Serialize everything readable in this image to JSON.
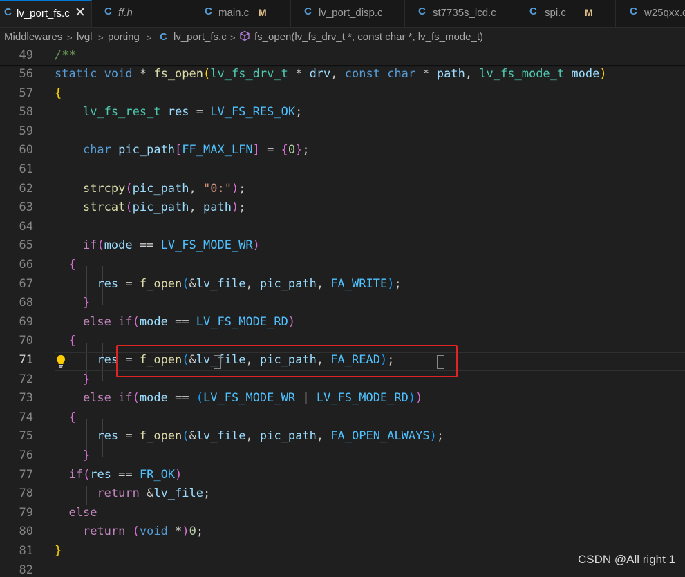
{
  "tabs": [
    {
      "icon": "C",
      "label": "lv_port_fs.c",
      "close": "✕"
    },
    {
      "icon": "C",
      "label": "ff.h"
    },
    {
      "icon": "C",
      "label": "main.c",
      "badge": "M"
    },
    {
      "icon": "C",
      "label": "lv_port_disp.c"
    },
    {
      "icon": "C",
      "label": "st7735s_lcd.c"
    },
    {
      "icon": "C",
      "label": "spi.c",
      "badge": "M"
    },
    {
      "icon": "C",
      "label": "w25qxx.c"
    }
  ],
  "breadcrumb": {
    "segments": [
      "Middlewares",
      "lvgl",
      "porting"
    ],
    "file_icon": "C",
    "file": "lv_port_fs.c",
    "symbol": "fs_open(lv_fs_drv_t *, const char *, lv_fs_mode_t)"
  },
  "editor": {
    "sticky_line": {
      "num": "49",
      "text": "/**"
    },
    "current_line": "71",
    "lines": [
      {
        "num": "56",
        "tokens": [
          [
            "static",
            "kw"
          ],
          [
            " ",
            ""
          ],
          [
            "void",
            "kw"
          ],
          [
            " * ",
            ""
          ],
          [
            "fs_open",
            "fn"
          ],
          [
            "(",
            "by"
          ],
          [
            "lv_fs_drv_t",
            "ty"
          ],
          [
            " * ",
            ""
          ],
          [
            "drv",
            "va"
          ],
          [
            ", ",
            ""
          ],
          [
            "const",
            "kw"
          ],
          [
            " ",
            ""
          ],
          [
            "char",
            "kw"
          ],
          [
            " * ",
            ""
          ],
          [
            "path",
            "va"
          ],
          [
            ", ",
            ""
          ],
          [
            "lv_fs_mode_t",
            "ty"
          ],
          [
            " ",
            ""
          ],
          [
            "mode",
            "va"
          ],
          [
            ")",
            "by"
          ]
        ]
      },
      {
        "num": "57",
        "tokens": [
          [
            "{",
            "by"
          ]
        ]
      },
      {
        "num": "58",
        "tokens": [
          [
            "    ",
            ""
          ],
          [
            "lv_fs_res_t",
            "ty"
          ],
          [
            " ",
            ""
          ],
          [
            "res",
            "va"
          ],
          [
            " = ",
            ""
          ],
          [
            "LV_FS_RES_OK",
            "cn"
          ],
          [
            ";",
            ""
          ]
        ]
      },
      {
        "num": "59",
        "tokens": []
      },
      {
        "num": "60",
        "tokens": [
          [
            "    ",
            ""
          ],
          [
            "char",
            "kw"
          ],
          [
            " ",
            ""
          ],
          [
            "pic_path",
            "va"
          ],
          [
            "[",
            "bp"
          ],
          [
            "FF_MAX_LFN",
            "cn"
          ],
          [
            "]",
            "bp"
          ],
          [
            " = ",
            ""
          ],
          [
            "{",
            "bp"
          ],
          [
            "0",
            "nu"
          ],
          [
            "}",
            "bp"
          ],
          [
            ";",
            ""
          ]
        ]
      },
      {
        "num": "61",
        "tokens": []
      },
      {
        "num": "62",
        "tokens": [
          [
            "    ",
            ""
          ],
          [
            "strcpy",
            "fn"
          ],
          [
            "(",
            "bp"
          ],
          [
            "pic_path",
            "va"
          ],
          [
            ", ",
            ""
          ],
          [
            "\"0:\"",
            "st"
          ],
          [
            ")",
            "bp"
          ],
          [
            ";",
            ""
          ]
        ]
      },
      {
        "num": "63",
        "tokens": [
          [
            "    ",
            ""
          ],
          [
            "strcat",
            "fn"
          ],
          [
            "(",
            "bp"
          ],
          [
            "pic_path",
            "va"
          ],
          [
            ", ",
            ""
          ],
          [
            "path",
            "va"
          ],
          [
            ")",
            "bp"
          ],
          [
            ";",
            ""
          ]
        ]
      },
      {
        "num": "64",
        "tokens": []
      },
      {
        "num": "65",
        "tokens": [
          [
            "    ",
            ""
          ],
          [
            "if",
            "ctl"
          ],
          [
            "(",
            "bp"
          ],
          [
            "mode",
            "va"
          ],
          [
            " == ",
            ""
          ],
          [
            "LV_FS_MODE_WR",
            "cn"
          ],
          [
            ")",
            "bp"
          ]
        ]
      },
      {
        "num": "66",
        "tokens": [
          [
            "  ",
            ""
          ],
          [
            "{",
            "bp"
          ]
        ]
      },
      {
        "num": "67",
        "tokens": [
          [
            "      ",
            ""
          ],
          [
            "res",
            "va"
          ],
          [
            " = ",
            ""
          ],
          [
            "f_open",
            "fn"
          ],
          [
            "(",
            "bb"
          ],
          [
            "&",
            ""
          ],
          [
            "lv_file",
            "va"
          ],
          [
            ", ",
            ""
          ],
          [
            "pic_path",
            "va"
          ],
          [
            ", ",
            ""
          ],
          [
            "FA_WRITE",
            "cn"
          ],
          [
            ")",
            "bb"
          ],
          [
            ";",
            ""
          ]
        ]
      },
      {
        "num": "68",
        "tokens": [
          [
            "    ",
            ""
          ],
          [
            "}",
            "bp"
          ]
        ]
      },
      {
        "num": "69",
        "tokens": [
          [
            "    ",
            ""
          ],
          [
            "else",
            "ctl"
          ],
          [
            " ",
            ""
          ],
          [
            "if",
            "ctl"
          ],
          [
            "(",
            "bp"
          ],
          [
            "mode",
            "va"
          ],
          [
            " == ",
            ""
          ],
          [
            "LV_FS_MODE_RD",
            "cn"
          ],
          [
            ")",
            "bp"
          ]
        ]
      },
      {
        "num": "70",
        "tokens": [
          [
            "  ",
            ""
          ],
          [
            "{",
            "bp"
          ]
        ]
      },
      {
        "num": "71",
        "tokens": [
          [
            "      ",
            ""
          ],
          [
            "res",
            "va"
          ],
          [
            " = ",
            ""
          ],
          [
            "f_open",
            "fn"
          ],
          [
            "(",
            "bb"
          ],
          [
            "&",
            ""
          ],
          [
            "lv_file",
            "va"
          ],
          [
            ", ",
            ""
          ],
          [
            "pic_path",
            "va"
          ],
          [
            ", ",
            ""
          ],
          [
            "FA_READ",
            "cn"
          ],
          [
            ")",
            "bb"
          ],
          [
            ";",
            ""
          ]
        ]
      },
      {
        "num": "72",
        "tokens": [
          [
            "    ",
            ""
          ],
          [
            "}",
            "bp"
          ]
        ]
      },
      {
        "num": "73",
        "tokens": [
          [
            "    ",
            ""
          ],
          [
            "else",
            "ctl"
          ],
          [
            " ",
            ""
          ],
          [
            "if",
            "ctl"
          ],
          [
            "(",
            "bp"
          ],
          [
            "mode",
            "va"
          ],
          [
            " == ",
            ""
          ],
          [
            "(",
            "bb"
          ],
          [
            "LV_FS_MODE_WR",
            "cn"
          ],
          [
            " | ",
            ""
          ],
          [
            "LV_FS_MODE_RD",
            "cn"
          ],
          [
            ")",
            "bb"
          ],
          [
            ")",
            "bp"
          ]
        ]
      },
      {
        "num": "74",
        "tokens": [
          [
            "  ",
            ""
          ],
          [
            "{",
            "bp"
          ]
        ]
      },
      {
        "num": "75",
        "tokens": [
          [
            "      ",
            ""
          ],
          [
            "res",
            "va"
          ],
          [
            " = ",
            ""
          ],
          [
            "f_open",
            "fn"
          ],
          [
            "(",
            "bb"
          ],
          [
            "&",
            ""
          ],
          [
            "lv_file",
            "va"
          ],
          [
            ", ",
            ""
          ],
          [
            "pic_path",
            "va"
          ],
          [
            ", ",
            ""
          ],
          [
            "FA_OPEN_ALWAYS",
            "cn"
          ],
          [
            ")",
            "bb"
          ],
          [
            ";",
            ""
          ]
        ]
      },
      {
        "num": "76",
        "tokens": [
          [
            "    ",
            ""
          ],
          [
            "}",
            "bp"
          ]
        ]
      },
      {
        "num": "77",
        "tokens": [
          [
            "  ",
            ""
          ],
          [
            "if",
            "ctl"
          ],
          [
            "(",
            "bp"
          ],
          [
            "res",
            "va"
          ],
          [
            " == ",
            ""
          ],
          [
            "FR_OK",
            "cn"
          ],
          [
            ")",
            "bp"
          ]
        ]
      },
      {
        "num": "78",
        "tokens": [
          [
            "      ",
            ""
          ],
          [
            "return",
            "ctl"
          ],
          [
            " &",
            ""
          ],
          [
            "lv_file",
            "va"
          ],
          [
            ";",
            ""
          ]
        ]
      },
      {
        "num": "79",
        "tokens": [
          [
            "  ",
            ""
          ],
          [
            "else",
            "ctl"
          ]
        ]
      },
      {
        "num": "80",
        "tokens": [
          [
            "    ",
            ""
          ],
          [
            "return",
            "ctl"
          ],
          [
            " ",
            ""
          ],
          [
            "(",
            "bp"
          ],
          [
            "void",
            "kw"
          ],
          [
            " *",
            ""
          ],
          [
            ")",
            "bp"
          ],
          [
            "0",
            "nu"
          ],
          [
            ";",
            ""
          ]
        ]
      },
      {
        "num": "81",
        "tokens": [
          [
            "}",
            "by"
          ]
        ]
      },
      {
        "num": "82",
        "tokens": []
      }
    ]
  },
  "watermark": "CSDN @All right 1",
  "colors": {
    "background": "#1f1f1f",
    "keyword": "#569cd6",
    "function": "#dcdcaa",
    "type": "#4ec9b0",
    "variable": "#9cdcfe",
    "constant": "#4fc1ff",
    "string": "#ce9178",
    "highlight_box": "#e02424",
    "modified_badge": "#e2c08d"
  },
  "icons": {
    "close": "close-icon",
    "lightbulb": "lightbulb-icon",
    "symbol": "method-cube-icon"
  }
}
